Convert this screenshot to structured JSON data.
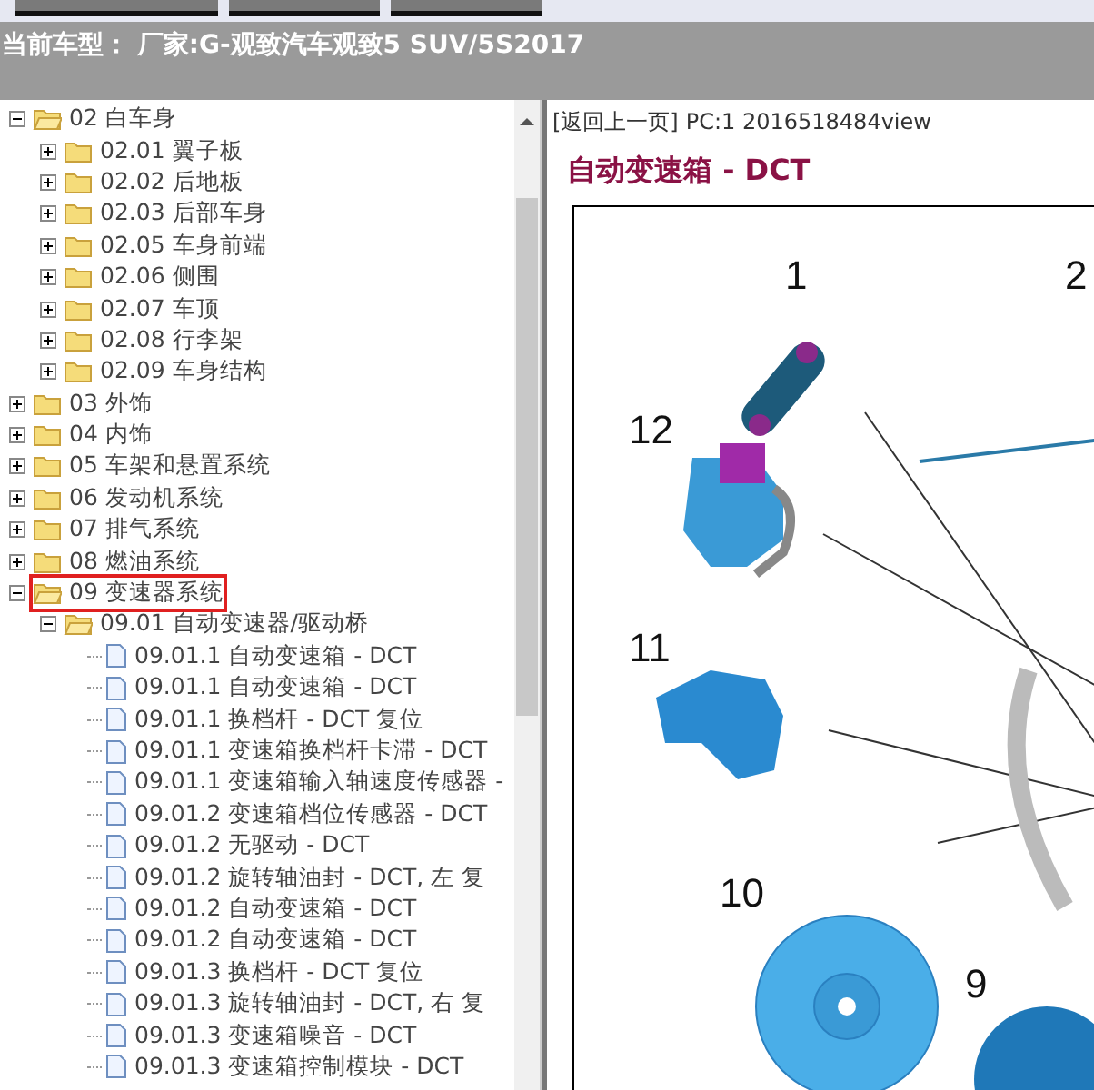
{
  "header": {
    "car_model": "当前车型： 厂家:G-观致汽车观致5 SUV/5S2017"
  },
  "tree": [
    {
      "label": "02 白车身",
      "expanded": true,
      "selected": false,
      "children": [
        {
          "label": "02.01 翼子板",
          "expanded": false,
          "selected": false
        },
        {
          "label": "02.02 后地板",
          "expanded": false,
          "selected": false
        },
        {
          "label": "02.03 后部车身",
          "expanded": false,
          "selected": false
        },
        {
          "label": "02.05 车身前端",
          "expanded": false,
          "selected": false
        },
        {
          "label": "02.06 侧围",
          "expanded": false,
          "selected": false
        },
        {
          "label": "02.07 车顶",
          "expanded": false,
          "selected": false
        },
        {
          "label": "02.08 行李架",
          "expanded": false,
          "selected": false
        },
        {
          "label": "02.09 车身结构",
          "expanded": false,
          "selected": false
        }
      ]
    },
    {
      "label": "03 外饰",
      "expanded": false,
      "selected": false
    },
    {
      "label": "04 内饰",
      "expanded": false,
      "selected": false
    },
    {
      "label": "05 车架和悬置系统",
      "expanded": false,
      "selected": false
    },
    {
      "label": "06 发动机系统",
      "expanded": false,
      "selected": false
    },
    {
      "label": "07 排气系统",
      "expanded": false,
      "selected": false
    },
    {
      "label": "08 燃油系统",
      "expanded": false,
      "selected": false
    },
    {
      "label": "09 变速器系统",
      "expanded": true,
      "selected": true,
      "children": [
        {
          "label": "09.01 自动变速器/驱动桥",
          "expanded": true,
          "selected": false,
          "children": [
            {
              "label": "09.01.1 自动变速箱 - DCT",
              "kind": "page",
              "selected": false
            },
            {
              "label": "09.01.1 自动变速箱 - DCT",
              "kind": "page",
              "selected": false
            },
            {
              "label": "09.01.1 换档杆 - DCT 复位",
              "kind": "page",
              "selected": false
            },
            {
              "label": "09.01.1 变速箱换档杆卡滞 - DCT",
              "kind": "page",
              "selected": false
            },
            {
              "label": "09.01.1 变速箱输入轴速度传感器 -",
              "kind": "page",
              "selected": false
            },
            {
              "label": "09.01.2 变速箱档位传感器 - DCT",
              "kind": "page",
              "selected": false
            },
            {
              "label": "09.01.2 无驱动 - DCT",
              "kind": "page",
              "selected": false
            },
            {
              "label": "09.01.2 旋转轴油封 - DCT, 左 复",
              "kind": "page",
              "selected": false
            },
            {
              "label": "09.01.2 自动变速箱 - DCT",
              "kind": "page",
              "selected": false
            },
            {
              "label": "09.01.2 自动变速箱 - DCT",
              "kind": "page",
              "selected": false
            },
            {
              "label": "09.01.3 换档杆 - DCT 复位",
              "kind": "page",
              "selected": false
            },
            {
              "label": "09.01.3 旋转轴油封 - DCT, 右 复",
              "kind": "page",
              "selected": false
            },
            {
              "label": "09.01.3 变速箱噪音 - DCT",
              "kind": "page",
              "selected": false
            },
            {
              "label": "09.01.3 变速箱控制模块 - DCT",
              "kind": "page",
              "selected": false
            }
          ]
        }
      ]
    }
  ],
  "content": {
    "back_link": "[返回上一页]",
    "page_info": "PC:1 2016518484view",
    "title": "自动变速箱 - DCT",
    "callouts": [
      "1",
      "2",
      "12",
      "11",
      "10",
      "9"
    ]
  }
}
